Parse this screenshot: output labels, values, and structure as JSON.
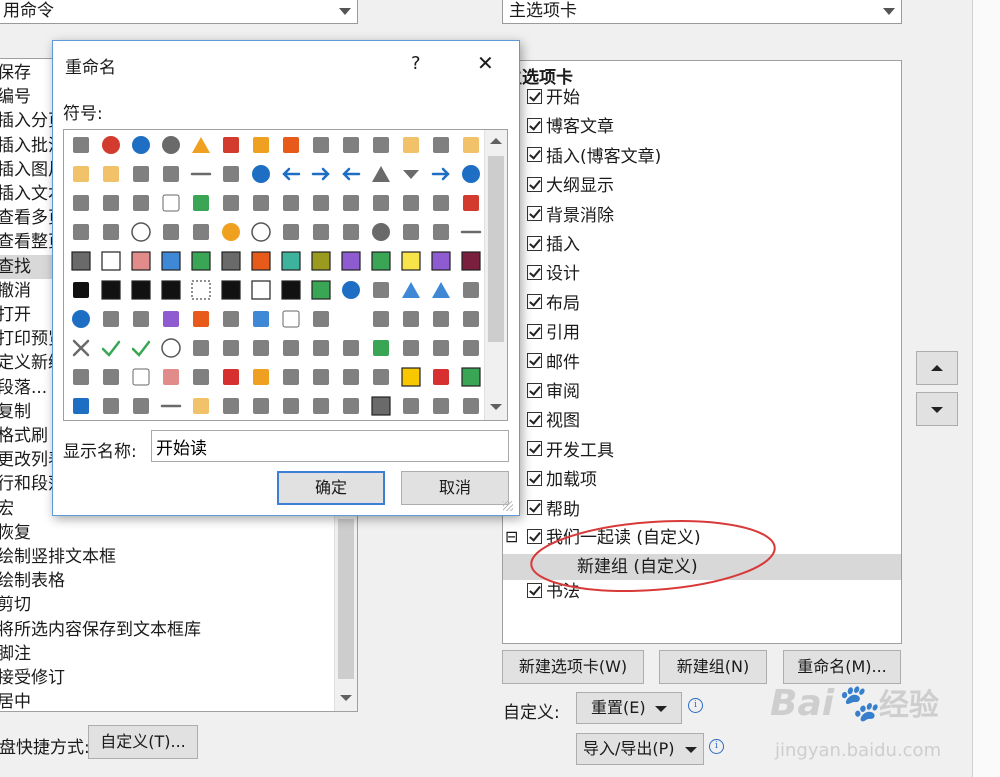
{
  "left_panel": {
    "combo_value": "用命令",
    "items": [
      {
        "label": "保存"
      },
      {
        "label": "编号"
      },
      {
        "label": "插入分页"
      },
      {
        "label": "插入批注"
      },
      {
        "label": "插入图片"
      },
      {
        "label": "插入文本"
      },
      {
        "label": "查看多页"
      },
      {
        "label": "查看整页"
      },
      {
        "label": "查找",
        "selected": true
      },
      {
        "label": "撤消"
      },
      {
        "label": "打开"
      },
      {
        "label": "打印预览"
      },
      {
        "label": "定义新编号"
      },
      {
        "label": "段落..."
      },
      {
        "label": "复制"
      },
      {
        "label": "格式刷"
      },
      {
        "label": "更改列表"
      },
      {
        "label": "行和段落"
      },
      {
        "label": "宏"
      },
      {
        "label": "恢复"
      },
      {
        "label": "绘制竖排文本框"
      },
      {
        "label": "绘制表格"
      },
      {
        "label": "剪切"
      },
      {
        "label": "将所选内容保存到文本框库"
      },
      {
        "label": "脚注"
      },
      {
        "label": "接受修订"
      },
      {
        "label": "居中"
      }
    ],
    "shortcut_label": "键盘快捷方式:",
    "customize_button": "自定义(T)..."
  },
  "right_panel": {
    "combo_value": "主选项卡",
    "tree_header": "主选项卡",
    "tabs": [
      {
        "label": "开始"
      },
      {
        "label": "博客文章"
      },
      {
        "label": "插入(博客文章)"
      },
      {
        "label": "大纲显示"
      },
      {
        "label": "背景消除"
      },
      {
        "label": "插入"
      },
      {
        "label": "设计"
      },
      {
        "label": "布局"
      },
      {
        "label": "引用"
      },
      {
        "label": "邮件"
      },
      {
        "label": "审阅"
      },
      {
        "label": "视图"
      },
      {
        "label": "开发工具"
      },
      {
        "label": "加载项"
      },
      {
        "label": "帮助"
      }
    ],
    "custom_tab": {
      "label": "我们一起读 (自定义)",
      "expander": "⊟"
    },
    "custom_group": {
      "label": "新建组 (自定义)"
    },
    "last_tab": {
      "label": "书法"
    },
    "new_tab_button": "新建选项卡(W)",
    "new_group_button": "新建组(N)",
    "rename_button": "重命名(M)...",
    "customize_label": "自定义:",
    "reset_button": "重置(E)",
    "import_export_button": "导入/导出(P)",
    "info_glyph": "i",
    "highlight_color": "#d83a3a"
  },
  "dialog": {
    "title": "重命名",
    "help_glyph": "?",
    "close_glyph": "✕",
    "symbol_label": "符号:",
    "display_name_label": "显示名称:",
    "display_name_value": "开始读",
    "ok_button": "确定",
    "cancel_button": "取消",
    "accent_color": "#3c7fd8",
    "icons": [
      [
        "org-chart-icon",
        "error-icon",
        "info-icon",
        "stop-icon",
        "warning-icon",
        "exclamation-icon",
        "alert-diamond-icon",
        "shield-icon",
        "save-icon",
        "save-all-icon",
        "save-as-icon",
        "folder-icon",
        "new-document-icon",
        "folder-open-icon"
      ],
      [
        "folder-move-icon",
        "folder-icon",
        "print-icon",
        "picture-icon",
        "document-lines-icon",
        "home-icon",
        "pie-chart-icon",
        "double-left-icon",
        "double-right-icon",
        "arrow-left-icon",
        "triangle-up-icon",
        "triangle-down-icon",
        "arrow-right-icon",
        "circle-left-icon"
      ],
      [
        "pin-icon",
        "lock-icon",
        "key-icon",
        "page-corner-icon",
        "page-play-icon",
        "film-icon",
        "search-icon",
        "funnel-icon",
        "funnel-icon",
        "book-icon",
        "scales-icon",
        "rings-icon",
        "microphone-icon",
        "mute-icon"
      ],
      [
        "user-icon",
        "people-icon",
        "clock-icon",
        "snowflake-icon",
        "hand-icon",
        "smiley-icon",
        "sad-icon",
        "calculator-icon",
        "phone-icon",
        "piggy-bank-icon",
        "eight-ball-icon",
        "quote-dollar-icon",
        "eye-icon",
        "line-icon"
      ],
      [
        "color-grid-icon",
        "white-square-icon",
        "rose-square-icon",
        "blue-square-icon",
        "green-square-icon",
        "gray-square-icon",
        "orange-square-icon",
        "teal-square-icon",
        "olive-square-icon",
        "purple-square-icon",
        "dark-green-square-icon",
        "yellow-square-icon",
        "violet-square-icon",
        "maroon-square-icon"
      ],
      [
        "contrast-icon",
        "black-square-icon",
        "frame-top-icon",
        "frame-icon",
        "dotted-square-icon",
        "frame-bottom-icon",
        "outline-square-icon",
        "bar-frame-icon",
        "checker-icon",
        "circle-right-icon",
        "bar-chart-icon",
        "pyramid-icon",
        "mountain-icon",
        "align-left-icon"
      ],
      [
        "pie-color-icon",
        "spider-web-icon",
        "database-icon",
        "purple-book-icon",
        "orange-book-icon",
        "eraser-doc-icon",
        "area-chart-icon",
        "page-icon",
        "contact-card-icon",
        "dashed-page-icon",
        "diagonal-icon",
        "flags-icon",
        "text-a-icon",
        "gray-a-icon"
      ],
      [
        "cross-icon",
        "check-icon",
        "ruler-check-icon",
        "refresh-icon",
        "binary-icon",
        "pi-icon",
        "paint-bucket-icon",
        "magnifier-icon",
        "brush-icon",
        "bullet-list-icon",
        "play-icon",
        "anchor-icon",
        "toolbox-icon",
        "lasso-icon"
      ],
      [
        "copy-icon",
        "panel-icon",
        "blank-page-icon",
        "pink-eraser-icon",
        "script-a-icon",
        "butterfly-icon",
        "bell-icon",
        "envelope-icon",
        "card-icon",
        "form-icon",
        "signature-icon",
        "gold-square-icon",
        "striped-red-icon",
        "green-tile-icon"
      ],
      [
        "ie-icon",
        "house-net-icon",
        "paper-plane-icon",
        "dash-line-icon",
        "sticky-note-icon",
        "world-doc-icon",
        "clipboard-icon",
        "cube-icon",
        "heart-pulse-icon",
        "camera-icon",
        "table-grid-icon",
        "window-icon",
        "cascade-icon",
        "certificate-icon"
      ]
    ]
  },
  "watermark": {
    "brand": "Bai",
    "brand_tail": "经验",
    "url": "jingyan.baidu.com"
  }
}
